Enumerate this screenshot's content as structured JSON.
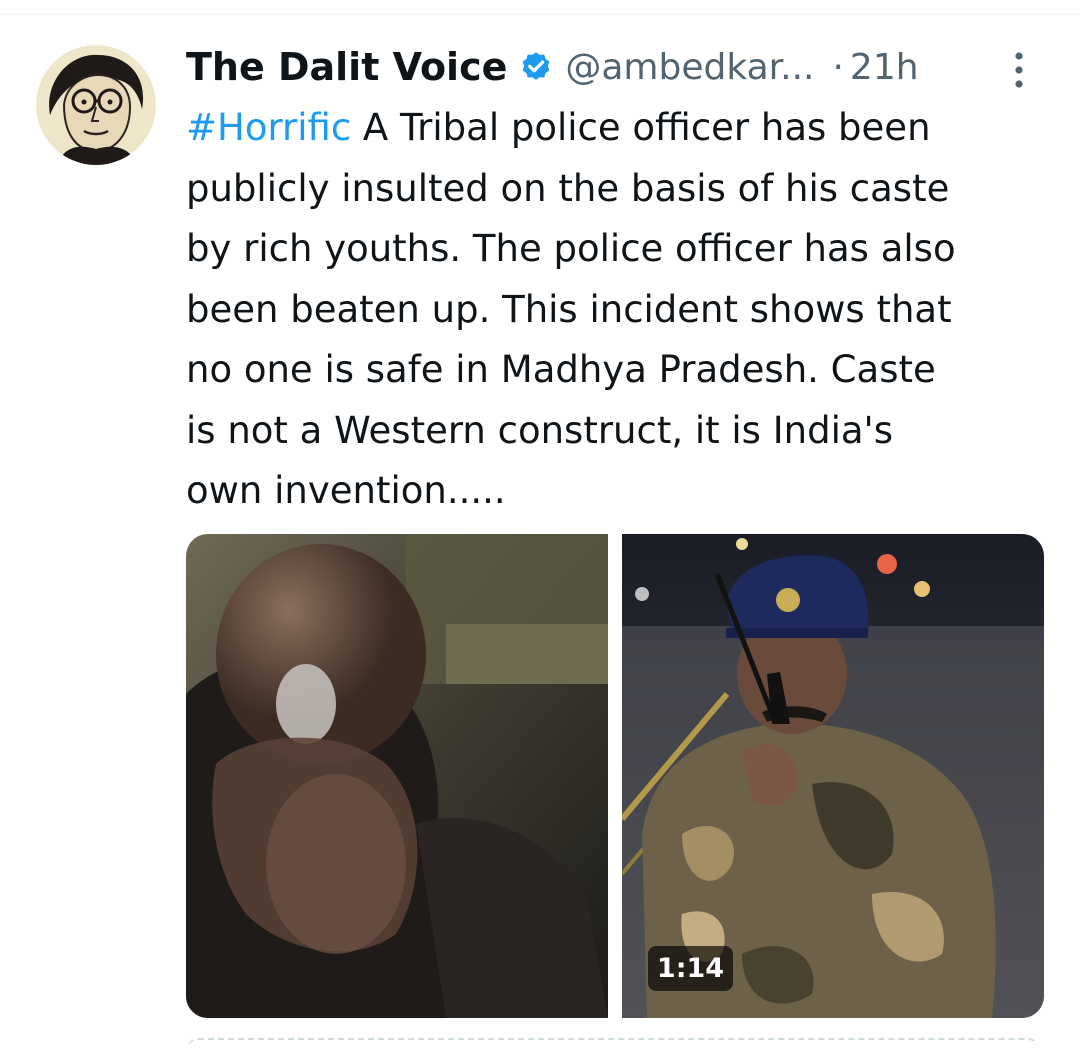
{
  "post": {
    "author": {
      "display_name": "The Dalit Voice",
      "handle": "@ambedkar...",
      "verified": true,
      "avatar_icon": "caricature-portrait"
    },
    "separator": "·",
    "time": "21h",
    "more_icon": "more-vertical-icon",
    "text": {
      "hashtag": "#Horrific",
      "line1_rest": " A Tribal police officer has been",
      "line2": "publicly insulted on the basis of his caste",
      "line3": "by rich youths. The police officer has also",
      "line4": "been beaten up. This incident shows that",
      "line5": "no one is safe in Madhya Pradesh. Caste",
      "line6": "is not a Western construct, it is India's",
      "line7": "own invention....."
    },
    "media": {
      "count": 2,
      "video_duration": "1:14"
    }
  },
  "colors": {
    "text": "#0f1419",
    "secondary": "#536471",
    "link": "#1d9bf0",
    "verified_badge": "#1d9bf0"
  }
}
